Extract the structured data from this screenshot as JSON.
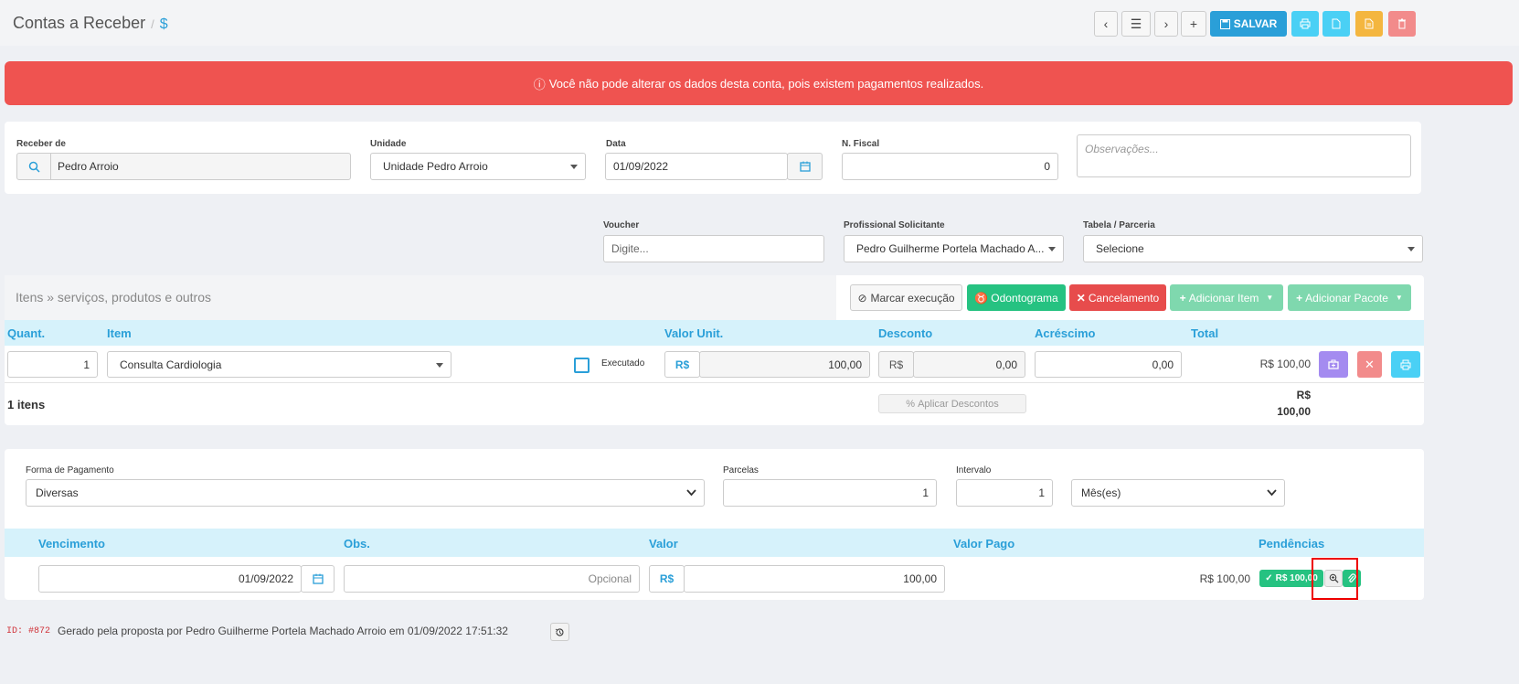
{
  "header": {
    "title": "Contas a Receber",
    "separator": "/",
    "dollar": "$",
    "save_label": "SALVAR",
    "prev_glyph": "‹",
    "list_glyph": "☰",
    "next_glyph": "›",
    "add_glyph": "+"
  },
  "alert": {
    "icon": "ⓘ",
    "text": "Você não pode alterar os dados desta conta, pois existem pagamentos realizados."
  },
  "form": {
    "receber_label": "Receber de",
    "receber_value": "Pedro Arroio",
    "unidade_label": "Unidade",
    "unidade_value": "Unidade Pedro Arroio",
    "data_label": "Data",
    "data_value": "01/09/2022",
    "fiscal_label": "N. Fiscal",
    "fiscal_value": "0",
    "obs_placeholder": "Observações...",
    "voucher_label": "Voucher",
    "voucher_placeholder": "Digite...",
    "profissional_label": "Profissional Solicitante",
    "profissional_value": "Pedro Guilherme Portela Machado A...",
    "tabela_label": "Tabela / Parceria",
    "tabela_value": "Selecione"
  },
  "items": {
    "title": "Itens » serviços, produtos e outros",
    "marcar_label": "Marcar execução",
    "odontograma_label": "Odontograma",
    "cancelamento_label": "Cancelamento",
    "adicionar_item_label": "Adicionar Item",
    "adicionar_pacote_label": "Adicionar Pacote",
    "columns": {
      "quant": "Quant.",
      "item": "Item",
      "valor_unit": "Valor Unit.",
      "desconto": "Desconto",
      "acrescimo": "Acréscimo",
      "total": "Total"
    },
    "row": {
      "quant": "1",
      "item": "Consulta Cardiologia",
      "executado_label": "Executado",
      "currency": "R$",
      "valor_unit": "100,00",
      "desconto_currency": "R$",
      "desconto": "0,00",
      "acrescimo": "0,00",
      "total": "R$ 100,00"
    },
    "count_label": "1 itens",
    "aplicar_label": "Aplicar Descontos",
    "footer_total_currency": "R$",
    "footer_total_value": "100,00"
  },
  "payment": {
    "forma_label": "Forma de Pagamento",
    "forma_value": "Diversas",
    "parcelas_label": "Parcelas",
    "parcelas_value": "1",
    "intervalo_label": "Intervalo",
    "intervalo_value": "1",
    "periodo_value": "Mês(es)",
    "columns": {
      "vencimento": "Vencimento",
      "obs": "Obs.",
      "valor": "Valor",
      "valor_pago": "Valor Pago",
      "pendencias": "Pendências"
    },
    "row": {
      "vencimento": "01/09/2022",
      "obs_placeholder": "Opcional",
      "currency": "R$",
      "valor": "100,00",
      "valor_pago": "R$ 100,00",
      "paid_badge": "R$ 100,00"
    }
  },
  "footer": {
    "id_label": "ID: #872",
    "text": "Gerado pela proposta por Pedro Guilherme Portela Machado Arroio em 01/09/2022 17:51:32"
  },
  "colors": {
    "primary": "#2a9fd8",
    "danger": "#ef5350",
    "success": "#26c281",
    "warning": "#f4b63f",
    "purple": "#a48bf0",
    "cyan": "#4ad0f5"
  }
}
